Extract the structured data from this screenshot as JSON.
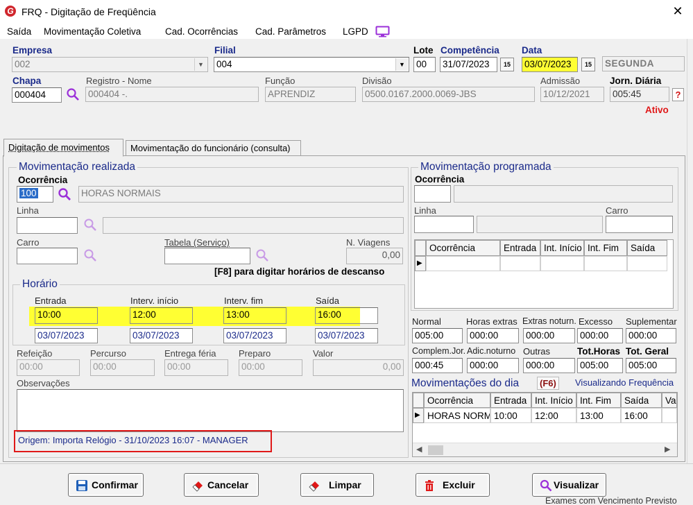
{
  "window": {
    "title": "FRQ - Digitação de Freqüência",
    "close": "✕"
  },
  "menu": [
    "Saída",
    "Movimentação Coletiva",
    "Cad. Ocorrências",
    "Cad. Parâmetros",
    "LGPD"
  ],
  "header": {
    "empresa_label": "Empresa",
    "empresa_value": "002",
    "filial_label": "Filial",
    "filial_value": "004",
    "lote_label": "Lote",
    "lote_value": "00",
    "competencia_label": "Competência",
    "competencia_value": "31/07/2023",
    "data_label": "Data",
    "data_value": "03/07/2023",
    "weekday": "SEGUNDA",
    "calendar_icon_text": "15",
    "chapa_label": "Chapa",
    "chapa_value": "000404",
    "registro_label": "Registro - Nome",
    "registro_value": "000404 -.",
    "funcao_label": "Função",
    "funcao_value": "APRENDIZ",
    "divisao_label": "Divisão",
    "divisao_value": "0500.0167.2000.0069-JBS",
    "admissao_label": "Admissão",
    "admissao_value": "10/12/2021",
    "jornada_label": "Jorn. Diária",
    "jornada_value": "005:45",
    "help": "?",
    "status": "Ativo"
  },
  "tabs": [
    "Digitação de movimentos",
    "Movimentação do funcionário (consulta)"
  ],
  "realizada": {
    "title": "Movimentação realizada",
    "ocorrencia_label": "Ocorrência",
    "ocorrencia_code": "100",
    "ocorrencia_desc": "HORAS NORMAIS",
    "linha_label": "Linha",
    "carro_label": "Carro",
    "tabela_label": "Tabela (Serviço)",
    "viagens_label": "N. Viagens",
    "viagens_value": "0,00",
    "f8_hint": "[F8] para digitar horários de descanso",
    "horario": {
      "title": "Horário",
      "entrada_label": "Entrada",
      "entrada_value": "10:00",
      "entrada_date": "03/07/2023",
      "interv_inicio_label": "Interv. início",
      "interv_inicio_value": "12:00",
      "interv_inicio_date": "03/07/2023",
      "interv_fim_label": "Interv. fim",
      "interv_fim_value": "13:00",
      "interv_fim_date": "03/07/2023",
      "saida_label": "Saída",
      "saida_value": "16:00",
      "saida_date": "03/07/2023"
    },
    "refeicao_label": "Refeição",
    "refeicao_value": "00:00",
    "percurso_label": "Percurso",
    "percurso_value": "00:00",
    "entrega_label": "Entrega féria",
    "entrega_value": "00:00",
    "preparo_label": "Preparo",
    "preparo_value": "00:00",
    "valor_label": "Valor",
    "valor_value": "0,00",
    "observacoes_label": "Observações",
    "origem": "Origem: Importa Relógio - 31/10/2023 16:07 - MANAGER"
  },
  "programada": {
    "title": "Movimentação programada",
    "ocorrencia_label": "Ocorrência",
    "linha_label": "Linha",
    "carro_label": "Carro",
    "grid_headers": [
      "Ocorrência",
      "Entrada",
      "Int. Início",
      "Int. Fim",
      "Saída"
    ]
  },
  "totals": {
    "normal_label": "Normal",
    "normal_value": "005:00",
    "horas_extras_label": "Horas extras",
    "horas_extras_value": "000:00",
    "extras_noturn_label": "Extras noturn.",
    "extras_noturn_value": "000:00",
    "excesso_label": "Excesso",
    "excesso_value": "000:00",
    "suplementar_label": "Suplementar",
    "suplementar_value": "000:00",
    "complem_label": "Complem.Jor.",
    "complem_value": "000:45",
    "adic_noturno_label": "Adic.noturno",
    "adic_noturno_value": "000:00",
    "outras_label": "Outras",
    "outras_value": "000:00",
    "tot_horas_label": "Tot.Horas",
    "tot_horas_value": "005:00",
    "tot_geral_label": "Tot. Geral",
    "tot_geral_value": "005:00"
  },
  "dia": {
    "title": "Movimentações do dia",
    "f6": "(F6)",
    "visualizando": "Visualizando Frequência",
    "grid_headers": [
      "Ocorrência",
      "Entrada",
      "Int. Início",
      "Int. Fim",
      "Saída",
      "Va"
    ],
    "rows": [
      [
        "HORAS NORMAIS",
        "10:00",
        "12:00",
        "13:00",
        "16:00",
        ""
      ]
    ]
  },
  "buttons": {
    "confirmar": "Confirmar",
    "cancelar": "Cancelar",
    "limpar": "Limpar",
    "excluir": "Excluir",
    "visualizar": "Visualizar"
  },
  "background_text": "Exames com Vencimento Previsto",
  "colors": {
    "accent": "#1a2a8a",
    "highlight": "#ffff33",
    "alert": "#e01818",
    "magnifier": "#9b30d9"
  }
}
